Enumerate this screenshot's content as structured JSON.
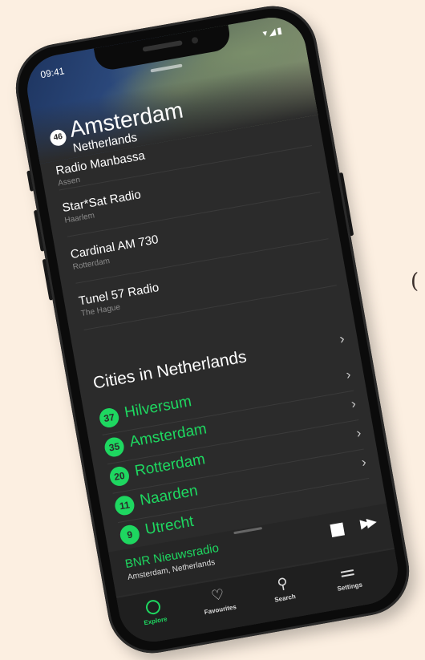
{
  "decoration": {
    "char": "("
  },
  "status": {
    "time": "09:41",
    "icons": "▾◢▮"
  },
  "header": {
    "badge": "46",
    "city": "Amsterdam",
    "country": "Netherlands"
  },
  "stations": [
    {
      "name": "Radio Manbassa",
      "location": "Assen"
    },
    {
      "name": "Star*Sat Radio",
      "location": "Haarlem"
    },
    {
      "name": "Cardinal AM 730",
      "location": "Rotterdam"
    },
    {
      "name": "Tunel 57 Radio",
      "location": "The Hague"
    }
  ],
  "cities_section": {
    "title": "Cities in Netherlands",
    "items": [
      {
        "count": "37",
        "name": "Hilversum"
      },
      {
        "count": "35",
        "name": "Amsterdam"
      },
      {
        "count": "20",
        "name": "Rotterdam"
      },
      {
        "count": "11",
        "name": "Naarden"
      },
      {
        "count": "9",
        "name": "Utrecht"
      }
    ]
  },
  "now_playing": {
    "station": "BNR Nieuwsradio",
    "location": "Amsterdam, Netherlands"
  },
  "tabs": [
    {
      "label": "Explore",
      "icon": "circle-icon",
      "active": true
    },
    {
      "label": "Favourites",
      "icon": "heart-icon",
      "active": false
    },
    {
      "label": "Search",
      "icon": "search-icon",
      "active": false
    },
    {
      "label": "Settings",
      "icon": "menu-icon",
      "active": false
    }
  ],
  "colors": {
    "accent": "#1ed760",
    "background": "#fcefe1",
    "screen": "#2b2b2b"
  }
}
